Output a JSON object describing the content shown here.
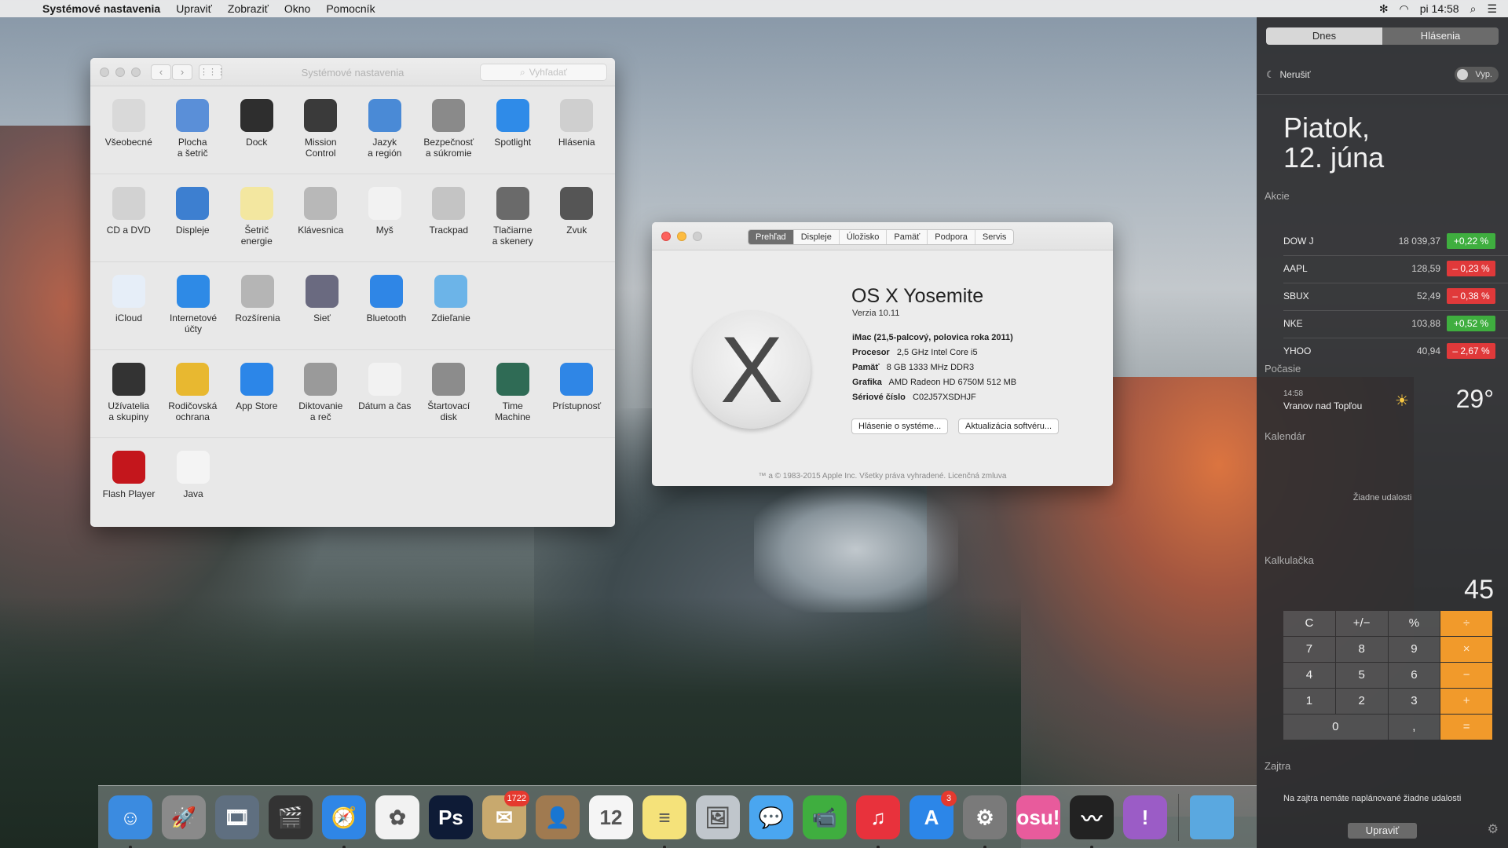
{
  "menubar": {
    "app_name": "Systémové nastavenia",
    "menus": [
      "Upraviť",
      "Zobraziť",
      "Okno",
      "Pomocník"
    ],
    "clock": "pi 14:58"
  },
  "prefs_window": {
    "title": "Systémové nastavenia",
    "search_placeholder": "Vyhľadať",
    "rows": [
      [
        {
          "label": "Všeobecné",
          "icon": "general-icon",
          "color": "#d9d9d9"
        },
        {
          "label": "Plocha\na šetrič",
          "icon": "desktop-icon",
          "color": "#5a8fd8"
        },
        {
          "label": "Dock",
          "icon": "dock-icon",
          "color": "#2e2e2e"
        },
        {
          "label": "Mission\nControl",
          "icon": "mission-control-icon",
          "color": "#3a3a3a"
        },
        {
          "label": "Jazyk\na región",
          "icon": "language-icon",
          "color": "#4a8ad6"
        },
        {
          "label": "Bezpečnosť\na súkromie",
          "icon": "security-icon",
          "color": "#8a8a8a"
        },
        {
          "label": "Spotlight",
          "icon": "spotlight-icon",
          "color": "#2f8be8"
        },
        {
          "label": "Hlásenia",
          "icon": "notifications-icon",
          "color": "#cfcfcf"
        }
      ],
      [
        {
          "label": "CD a DVD",
          "icon": "cd-icon",
          "color": "#d2d2d2"
        },
        {
          "label": "Displeje",
          "icon": "displays-icon",
          "color": "#3d7fd0"
        },
        {
          "label": "Šetrič\nenergie",
          "icon": "energy-icon",
          "color": "#f3e7a0"
        },
        {
          "label": "Klávesnica",
          "icon": "keyboard-icon",
          "color": "#b8b8b8"
        },
        {
          "label": "Myš",
          "icon": "mouse-icon",
          "color": "#f2f2f2"
        },
        {
          "label": "Trackpad",
          "icon": "trackpad-icon",
          "color": "#c4c4c4"
        },
        {
          "label": "Tlačiarne\na skenery",
          "icon": "printer-icon",
          "color": "#6a6a6a"
        },
        {
          "label": "Zvuk",
          "icon": "sound-icon",
          "color": "#555555"
        }
      ],
      [
        {
          "label": "iCloud",
          "icon": "icloud-icon",
          "color": "#e6eef8"
        },
        {
          "label": "Internetové\núčty",
          "icon": "internet-accounts-icon",
          "color": "#2e8ae6"
        },
        {
          "label": "Rozšírenia",
          "icon": "extensions-icon",
          "color": "#b5b5b5"
        },
        {
          "label": "Sieť",
          "icon": "network-icon",
          "color": "#6a6a80"
        },
        {
          "label": "Bluetooth",
          "icon": "bluetooth-icon",
          "color": "#2f86e6"
        },
        {
          "label": "Zdieľanie",
          "icon": "sharing-icon",
          "color": "#6cb4e8"
        }
      ],
      [
        {
          "label": "Užívatelia\na skupiny",
          "icon": "users-icon",
          "color": "#333333"
        },
        {
          "label": "Rodičovská\nochrana",
          "icon": "parental-icon",
          "color": "#e8b830"
        },
        {
          "label": "App Store",
          "icon": "app-store-icon",
          "color": "#2c86e8"
        },
        {
          "label": "Diktovanie\na reč",
          "icon": "dictation-icon",
          "color": "#9a9a9a"
        },
        {
          "label": "Dátum a čas",
          "icon": "date-time-icon",
          "color": "#f2f2f2"
        },
        {
          "label": "Štartovací\ndisk",
          "icon": "startup-disk-icon",
          "color": "#8c8c8c"
        },
        {
          "label": "Time\nMachine",
          "icon": "time-machine-icon",
          "color": "#2f6b55"
        },
        {
          "label": "Prístupnosť",
          "icon": "accessibility-icon",
          "color": "#2f86e6"
        }
      ],
      [
        {
          "label": "Flash Player",
          "icon": "flash-icon",
          "color": "#c4161c"
        },
        {
          "label": "Java",
          "icon": "java-icon",
          "color": "#f4f4f4"
        }
      ]
    ]
  },
  "about_window": {
    "tabs": [
      "Prehľad",
      "Displeje",
      "Úložisko",
      "Pamäť",
      "Podpora",
      "Servis"
    ],
    "active_tab": "Prehľad",
    "os_name": "OS X Yosemite",
    "version": "Verzia 10.11",
    "model": "iMac (21,5-palcový, polovica roka 2011)",
    "specs": [
      {
        "label": "Procesor",
        "value": "2,5 GHz Intel Core i5"
      },
      {
        "label": "Pamäť",
        "value": "8 GB 1333 MHz DDR3"
      },
      {
        "label": "Grafika",
        "value": "AMD Radeon HD 6750M 512 MB"
      },
      {
        "label": "Sériové číslo",
        "value": "C02J57XSDHJF"
      }
    ],
    "button_report": "Hlásenie o systéme...",
    "button_update": "Aktualizácia softvéru...",
    "legal": "™ a © 1983-2015 Apple Inc. Všetky práva vyhradené. Licenčná zmluva"
  },
  "notification_center": {
    "tab_today": "Dnes",
    "tab_notifications": "Hlásenia",
    "dnd_label": "Nerušiť",
    "dnd_state": "Vyp.",
    "day": "Piatok,",
    "date": "12. júna",
    "stocks_title": "Akcie",
    "stocks": [
      {
        "symbol": "DOW J",
        "price": "18 039,37",
        "change": "+0,22 %",
        "up": true
      },
      {
        "symbol": "AAPL",
        "price": "128,59",
        "change": "– 0,23 %",
        "up": false
      },
      {
        "symbol": "SBUX",
        "price": "52,49",
        "change": "– 0,38 %",
        "up": false
      },
      {
        "symbol": "NKE",
        "price": "103,88",
        "change": "+0,52 %",
        "up": true
      },
      {
        "symbol": "YHOO",
        "price": "40,94",
        "change": "– 2,67 %",
        "up": false
      }
    ],
    "weather_title": "Počasie",
    "weather_time": "14:58",
    "weather_city": "Vranov nad Topľou",
    "weather_temp": "29°",
    "calendar_title": "Kalendár",
    "calendar_empty": "Žiadne udalosti",
    "calc_title": "Kalkulačka",
    "calc_display": "45",
    "calc_keys": [
      "C",
      "+/−",
      "%",
      "÷",
      "7",
      "8",
      "9",
      "×",
      "4",
      "5",
      "6",
      "−",
      "1",
      "2",
      "3",
      "+",
      "0",
      ",",
      "="
    ],
    "tomorrow_title": "Zajtra",
    "tomorrow_text": "Na zajtra nemáte naplánované žiadne udalosti",
    "edit_button": "Upraviť"
  },
  "dock": {
    "apps": [
      {
        "name": "finder-icon",
        "color": "#3b8be0",
        "glyph": "☺",
        "running": true
      },
      {
        "name": "launchpad-icon",
        "color": "#8a8a8a",
        "glyph": "🚀",
        "running": false
      },
      {
        "name": "image-capture-icon",
        "color": "#5f6f80",
        "glyph": "🎞",
        "running": false
      },
      {
        "name": "final-cut-icon",
        "color": "#333333",
        "glyph": "🎬",
        "running": false
      },
      {
        "name": "safari-icon",
        "color": "#2f86e6",
        "glyph": "🧭",
        "running": true
      },
      {
        "name": "photos-icon",
        "color": "#f2f2f2",
        "glyph": "✿",
        "running": false
      },
      {
        "name": "photoshop-icon",
        "color": "#0e1b36",
        "glyph": "Ps",
        "running": false
      },
      {
        "name": "mail-icon",
        "color": "#c8a96e",
        "glyph": "✉",
        "running": false,
        "badge": "1722"
      },
      {
        "name": "contacts-icon",
        "color": "#a07a50",
        "glyph": "👤",
        "running": false
      },
      {
        "name": "calendar-icon",
        "color": "#f5f5f5",
        "glyph": "12",
        "running": false
      },
      {
        "name": "notes-icon",
        "color": "#f5e27a",
        "glyph": "≡",
        "running": true
      },
      {
        "name": "preview-icon",
        "color": "#c0c6cc",
        "glyph": "🖼",
        "running": false
      },
      {
        "name": "messages-icon",
        "color": "#4aa6f0",
        "glyph": "💬",
        "running": false
      },
      {
        "name": "facetime-icon",
        "color": "#3fae3f",
        "glyph": "📹",
        "running": false
      },
      {
        "name": "itunes-icon",
        "color": "#e8323c",
        "glyph": "♫",
        "running": true
      },
      {
        "name": "app-store-dock-icon",
        "color": "#2c86e8",
        "glyph": "A",
        "running": false,
        "badge": "3"
      },
      {
        "name": "system-preferences-icon",
        "color": "#7a7a7a",
        "glyph": "⚙",
        "running": true
      },
      {
        "name": "osu-icon",
        "color": "#e85b9c",
        "glyph": "osu!",
        "running": false
      },
      {
        "name": "activity-monitor-icon",
        "color": "#222222",
        "glyph": "〰",
        "running": true
      },
      {
        "name": "feedback-icon",
        "color": "#9b5cc6",
        "glyph": "!",
        "running": false
      }
    ],
    "folder_color": "#5aa8e0"
  },
  "colors": {
    "stock_up": "#3fae3f",
    "stock_down": "#e0393a",
    "calc_op": "#f19a2b"
  }
}
